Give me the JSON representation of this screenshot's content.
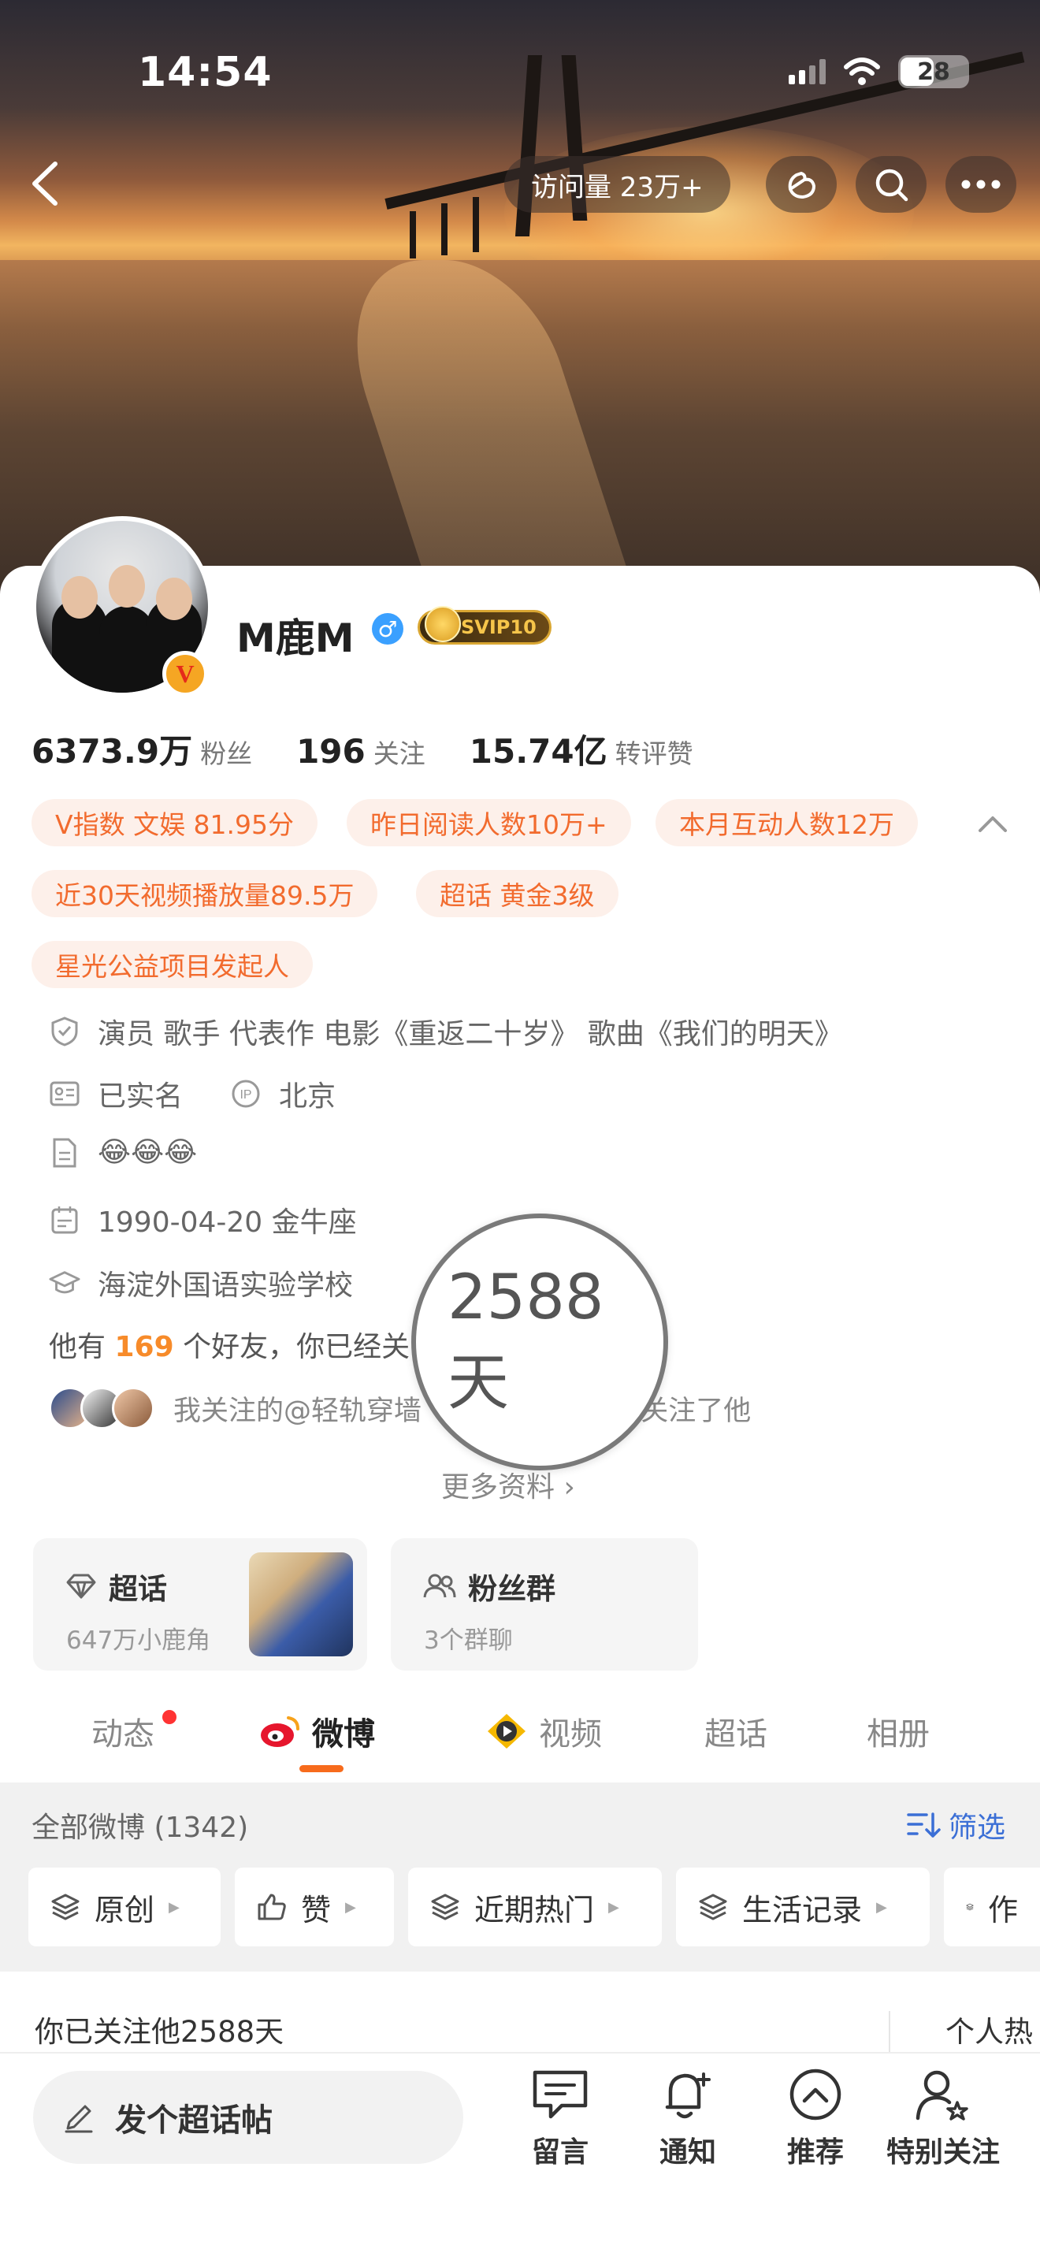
{
  "status_bar": {
    "time": "14:54",
    "battery": "28"
  },
  "header": {
    "visits": "访问量 23万+"
  },
  "profile": {
    "name": "M鹿M",
    "vip_badge": "SVIP10",
    "verified_mark": "V",
    "gender_mark": "♂",
    "stats": [
      {
        "num": "6373.9万",
        "label": "粉丝"
      },
      {
        "num": "196",
        "label": "关注"
      },
      {
        "num": "15.74亿",
        "label": "转评赞"
      }
    ],
    "tags": [
      "V指数 文娱 81.95分",
      "昨日阅读人数10万+",
      "本月互动人数12万",
      "近30天视频播放量89.5万",
      "超话 黄金3级",
      "星光公益项目发起人"
    ],
    "info": {
      "occupation": "演员 歌手 代表作 电影《重返二十岁》 歌曲《我们的明天》",
      "verified": "已实名",
      "ip_label": "IP",
      "ip": "北京",
      "bio": "😂😂😂",
      "birthday": "1990-04-20 金牛座",
      "school": "海淀外国语实验学校"
    },
    "friends_prefix": "他有",
    "friends_count": "169",
    "friends_suffix": "个好友，你已经关",
    "magnified_text": "2588 天",
    "follows_left": "我关注的@轻轨穿墙",
    "follows_right": "3人也关注了他",
    "more_info": "更多资料 ›"
  },
  "widgets": [
    {
      "title": "超话",
      "sub": "647万小鹿角"
    },
    {
      "title": "粉丝群",
      "sub": "3个群聊"
    }
  ],
  "tabs": [
    "动态",
    "微博",
    "视频",
    "超话",
    "相册"
  ],
  "feed": {
    "title": "全部微博 (1342)",
    "filter": "筛选",
    "chips": [
      "原创",
      "赞",
      "近期热门",
      "生活记录",
      "作"
    ],
    "post_left": "你已关注他2588天",
    "post_right": "个人热"
  },
  "bottom": {
    "compose": "发个超话帖",
    "items": [
      "留言",
      "通知",
      "推荐",
      "特别关注"
    ]
  }
}
